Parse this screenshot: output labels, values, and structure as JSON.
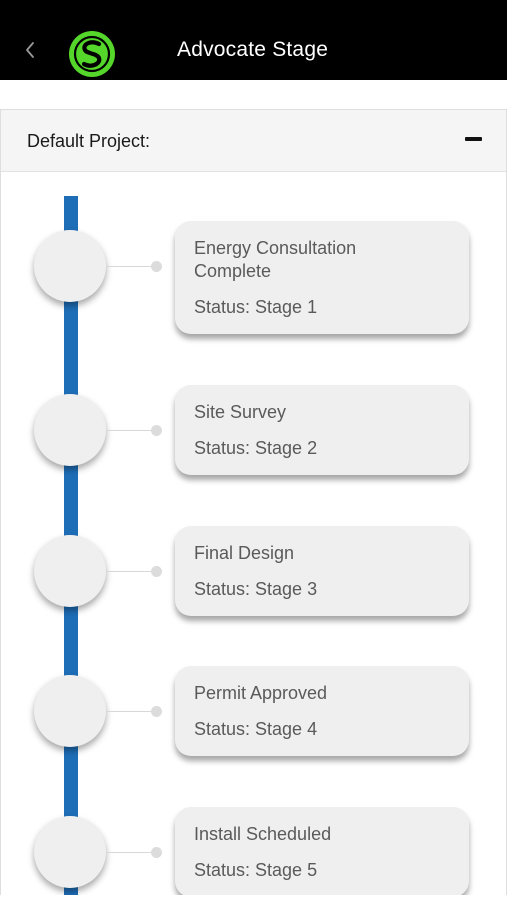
{
  "header": {
    "title": "Advocate Stage",
    "back_icon": "chevron-left-icon",
    "logo_icon": "brand-logo-icon",
    "background": "#000000",
    "logo_color": "#55d62b"
  },
  "project": {
    "title": "Default Project:",
    "collapse_icon": "minus-icon"
  },
  "timeline": {
    "line_color": "#1e6eb7",
    "steps": [
      {
        "title": "Energy Consultation Complete",
        "status": "Status: Stage 1"
      },
      {
        "title": "Site Survey",
        "status": "Status: Stage 2"
      },
      {
        "title": "Final Design",
        "status": "Status: Stage 3"
      },
      {
        "title": "Permit Approved",
        "status": "Status: Stage 4"
      },
      {
        "title": "Install Scheduled",
        "status": "Status: Stage 5"
      }
    ]
  }
}
